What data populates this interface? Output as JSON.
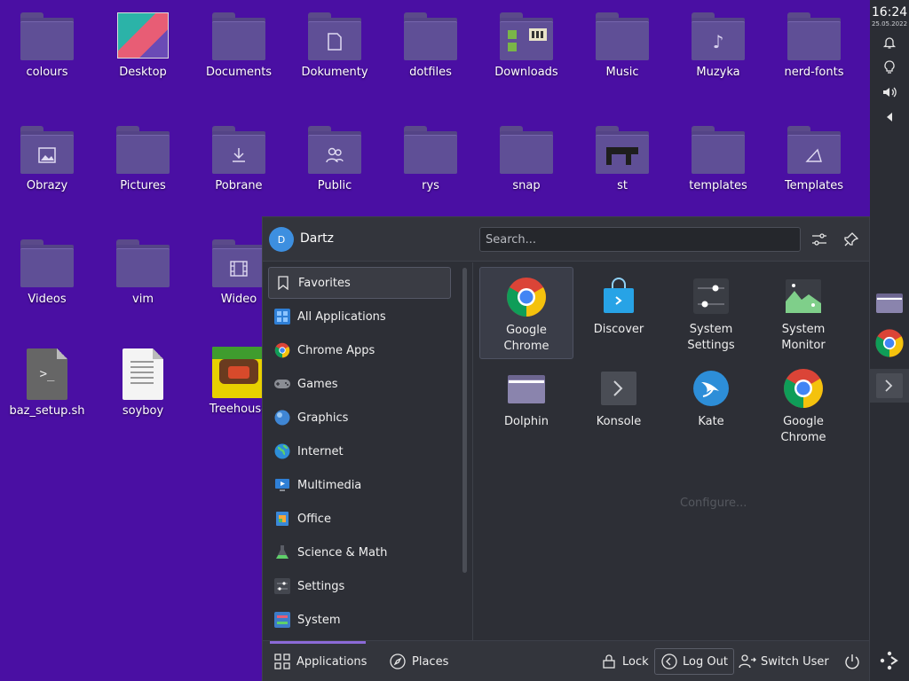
{
  "desktop": {
    "row1": [
      {
        "label": "colours"
      },
      {
        "label": "Desktop"
      },
      {
        "label": "Documents"
      },
      {
        "label": "Dokumenty"
      },
      {
        "label": "dotfiles"
      },
      {
        "label": "Downloads"
      },
      {
        "label": "Music"
      },
      {
        "label": "Muzyka"
      },
      {
        "label": "nerd-fonts"
      }
    ],
    "row2": [
      {
        "label": "Obrazy"
      },
      {
        "label": "Pictures"
      },
      {
        "label": "Pobrane"
      },
      {
        "label": "Public"
      },
      {
        "label": "rys"
      },
      {
        "label": "snap"
      },
      {
        "label": "st"
      },
      {
        "label": "templates"
      },
      {
        "label": "Templates"
      }
    ],
    "row3": [
      {
        "label": "Videos"
      },
      {
        "label": "vim"
      },
      {
        "label": "Wideo"
      }
    ],
    "row4": [
      {
        "label": "baz_setup.sh"
      },
      {
        "label": "soyboy"
      },
      {
        "label": "Treehouse"
      }
    ]
  },
  "panel": {
    "time": "16:24",
    "date": "25.05.2022"
  },
  "launcher": {
    "user": {
      "name": "Dartz",
      "initial": "D"
    },
    "search": {
      "placeholder": "Search..."
    },
    "categories": [
      {
        "label": "Favorites"
      },
      {
        "label": "All Applications"
      },
      {
        "label": "Chrome Apps"
      },
      {
        "label": "Games"
      },
      {
        "label": "Graphics"
      },
      {
        "label": "Internet"
      },
      {
        "label": "Multimedia"
      },
      {
        "label": "Office"
      },
      {
        "label": "Science & Math"
      },
      {
        "label": "Settings"
      },
      {
        "label": "System"
      }
    ],
    "favorites": [
      {
        "label": "Google Chrome"
      },
      {
        "label": "Discover"
      },
      {
        "label": "System Settings"
      },
      {
        "label": "System Monitor"
      },
      {
        "label": "Dolphin"
      },
      {
        "label": "Konsole"
      },
      {
        "label": "Kate"
      },
      {
        "label": "Google Chrome"
      }
    ],
    "configure_hint": "Configure...",
    "footer": {
      "applications": "Applications",
      "places": "Places",
      "lock": "Lock",
      "logout": "Log Out",
      "switch_user": "Switch User"
    }
  },
  "colors": {
    "desktop_bg": "#4a0fa3",
    "panel_bg": "#2b2d34",
    "launcher_bg": "#2d2f36",
    "accent": "#8c6ad8"
  }
}
